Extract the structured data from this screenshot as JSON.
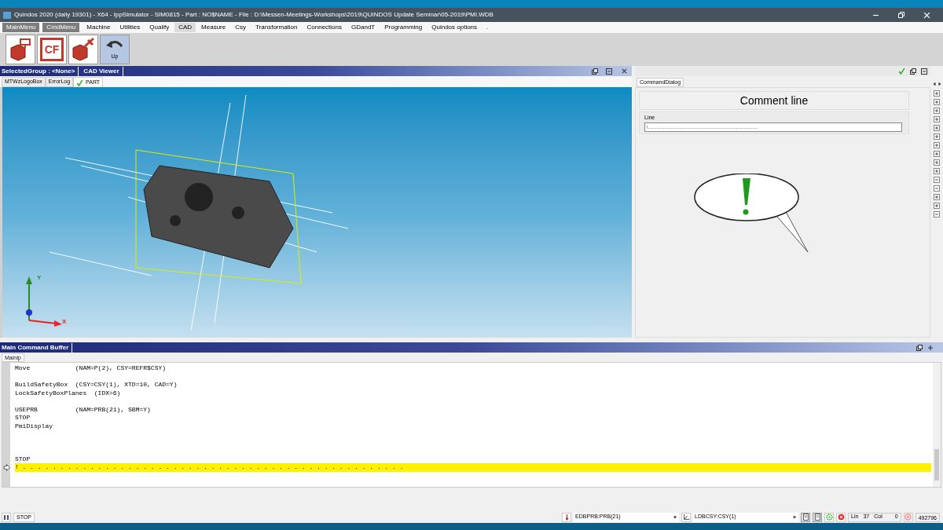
{
  "title_bar": {
    "title": "Quindos 2020 (daily 19301) - X64 - IppSimulator - SIM0815 - Part : NO$NAME - File : D:\\Messen-Meetings-Workshops\\2019\\QUINDOS Update Seminar\\05-2019\\PMI.WDB"
  },
  "menu": [
    {
      "label": "MainMenu",
      "kind": "button",
      "selected": false
    },
    {
      "label": "CmdMenu",
      "kind": "button",
      "selected": false
    },
    {
      "label": "Machine",
      "kind": "item",
      "selected": false
    },
    {
      "label": "Utilities",
      "kind": "item",
      "selected": false
    },
    {
      "label": "Qualify",
      "kind": "item",
      "selected": false
    },
    {
      "label": "CAD",
      "kind": "item",
      "selected": true
    },
    {
      "label": "Measure",
      "kind": "item",
      "selected": false
    },
    {
      "label": "Csy",
      "kind": "item",
      "selected": false
    },
    {
      "label": "Transformation",
      "kind": "item",
      "selected": false
    },
    {
      "label": "Connections",
      "kind": "item",
      "selected": false
    },
    {
      "label": "GDandT",
      "kind": "item",
      "selected": false
    },
    {
      "label": "Programming",
      "kind": "item",
      "selected": false
    },
    {
      "label": "Quindos options",
      "kind": "item",
      "selected": false
    },
    {
      "label": ".",
      "kind": "item",
      "selected": false
    }
  ],
  "toolbar": [
    {
      "kind": "group"
    },
    {
      "kind": "cf",
      "text": "CF"
    },
    {
      "kind": "measure"
    },
    {
      "kind": "up",
      "label": "Up"
    }
  ],
  "viewer": {
    "header": [
      "SelectedGroup : <None>",
      "CAD Viewer"
    ],
    "tabs": [
      {
        "label": "MTWzLogoBox",
        "selected": false,
        "checked": false
      },
      {
        "label": "ErrorLog",
        "selected": false,
        "checked": false
      },
      {
        "label": "PART",
        "selected": true,
        "checked": true
      }
    ],
    "axes": {
      "x": "X",
      "y": "Y"
    }
  },
  "command_dialog": {
    "tab": "CommandDialog",
    "title": "Comment line",
    "field_label": "Line",
    "field_value": "!....................................................................................................."
  },
  "side_tree": [
    {
      "expanded": false
    },
    {
      "expanded": false
    },
    {
      "expanded": false
    },
    {
      "expanded": false
    },
    {
      "expanded": false
    },
    {
      "expanded": false
    },
    {
      "expanded": false
    },
    {
      "expanded": false
    },
    {
      "expanded": false
    },
    {
      "expanded": false
    },
    {
      "expanded": true
    },
    {
      "expanded": true
    },
    {
      "expanded": false
    },
    {
      "expanded": false
    },
    {
      "expanded": true
    }
  ],
  "buffer": {
    "header": "Main Command Buffer",
    "tab": "MainIp",
    "lines": [
      {
        "kind": "code",
        "text": "Move            (NAM=P(2), CSY=REFR$CSY)",
        "current": false
      },
      {
        "kind": "blank"
      },
      {
        "kind": "code",
        "text": "BuildSafetyBox  (CSY=CSY(1), XTD=10, CAD=Y)",
        "current": false
      },
      {
        "kind": "code",
        "text": "LockSafetyBoxPlanes  (IDX=6)",
        "current": false
      },
      {
        "kind": "blank"
      },
      {
        "kind": "code",
        "text": "USEPRB          (NAM=PRB(21), SBM=Y)",
        "current": false
      },
      {
        "kind": "code",
        "text": "STOP",
        "current": false
      },
      {
        "kind": "code",
        "text": "PmiDisplay",
        "current": false
      },
      {
        "kind": "blank"
      },
      {
        "kind": "blank"
      },
      {
        "kind": "blank"
      },
      {
        "kind": "code",
        "text": "STOP",
        "current": false
      },
      {
        "kind": "code",
        "text": "! . . . . . . . . . . . . . . . . . . . . . . . . . . . . . . . . . . . . . . . . . . . . . . . . . . .",
        "current": true
      }
    ]
  },
  "status_bar": {
    "stop": "STOP",
    "probe": "EDBPRB:PRB(21)",
    "csy": "LDBCSY:CSY(1)",
    "lin_label": "Lin",
    "lin": "37",
    "col_label": "Col",
    "col": "0",
    "count": "492796"
  }
}
